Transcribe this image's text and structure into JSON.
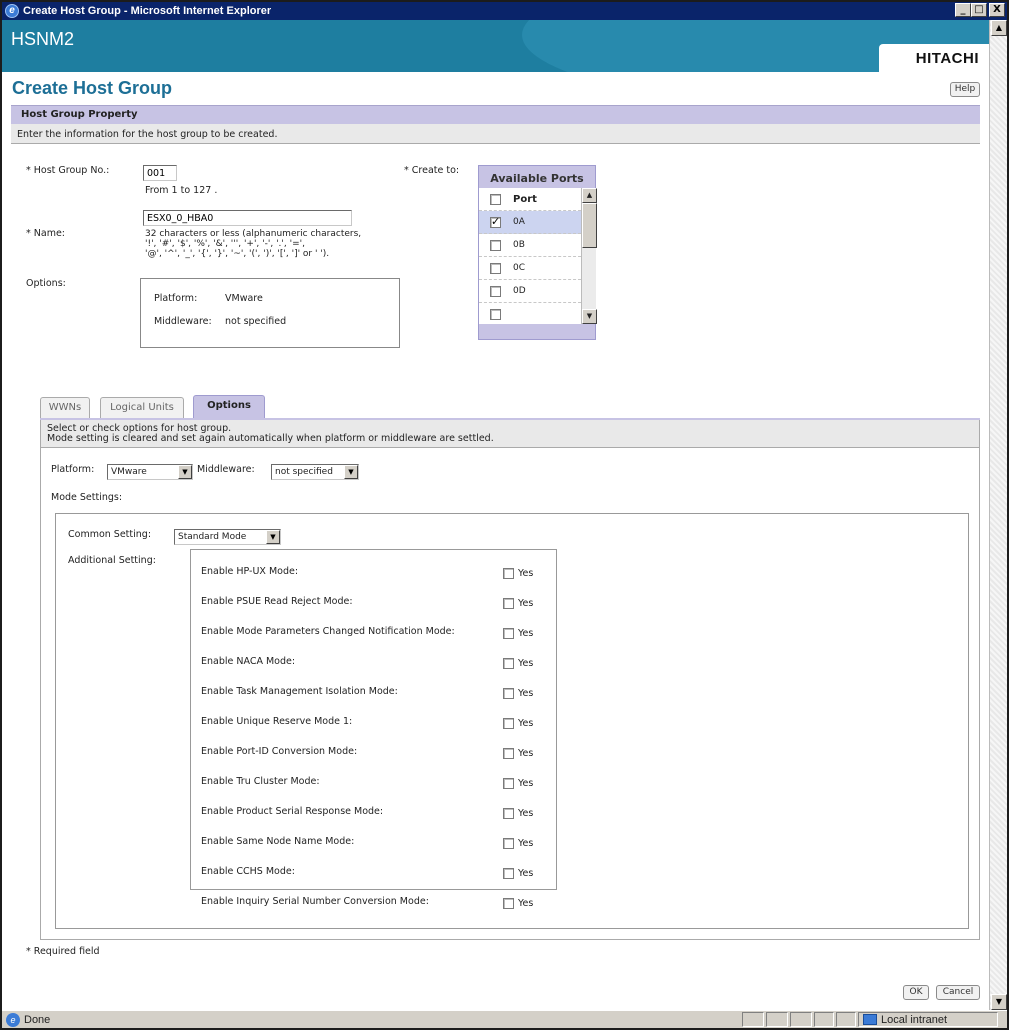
{
  "window": {
    "title": "Create Host Group - Microsoft Internet Explorer",
    "min": "_",
    "max": "□",
    "close": "X"
  },
  "banner": {
    "app_name": "HSNM2",
    "logo": "HITACHI"
  },
  "page": {
    "title": "Create Host Group",
    "help_label": "Help"
  },
  "property": {
    "header": "Host Group Property",
    "description": "Enter the information for the host group to be created.",
    "host_group_no_label": "* Host Group No.:",
    "host_group_no_value": "001",
    "host_group_no_hint": "From 1 to 127 .",
    "name_label": "* Name:",
    "name_value": "ESX0_0_HBA0",
    "name_hint_1": "32 characters or less (alphanumeric characters,",
    "name_hint_2": "'!', '#', '$', '%', '&', ''', '+', '-', '.', '=',",
    "name_hint_3": "'@', '^', '_', '{', '}', '~', '(', ')', '[', ']' or ' ').",
    "options_label": "Options:",
    "options_platform_label": "Platform:",
    "options_platform_value": "VMware",
    "options_middleware_label": "Middleware:",
    "options_middleware_value": "not specified",
    "create_to_label": "* Create to:"
  },
  "ports": {
    "title": "Available Ports",
    "column": "Port",
    "items": [
      {
        "label": "0A",
        "checked": true
      },
      {
        "label": "0B",
        "checked": false
      },
      {
        "label": "0C",
        "checked": false
      },
      {
        "label": "0D",
        "checked": false
      }
    ]
  },
  "tabs": [
    {
      "label": "WWNs",
      "active": false
    },
    {
      "label": "Logical Units",
      "active": false
    },
    {
      "label": "Options",
      "active": true
    }
  ],
  "options_tab": {
    "description_1": "Select or check options for host group.",
    "description_2": "Mode setting is cleared and set again automatically when platform or middleware are settled.",
    "platform_label": "Platform:",
    "platform_value": "VMware",
    "middleware_label": "Middleware:",
    "middleware_value": "not specified",
    "mode_settings_label": "Mode Settings:",
    "common_setting_label": "Common Setting:",
    "common_setting_value": "Standard Mode",
    "additional_setting_label": "Additional Setting:",
    "yes_label": "Yes",
    "additional": [
      "Enable HP-UX Mode:",
      "Enable PSUE Read Reject Mode:",
      "Enable Mode Parameters Changed Notification Mode:",
      "Enable NACA Mode:",
      "Enable Task Management Isolation Mode:",
      "Enable Unique Reserve Mode 1:",
      "Enable Port-ID Conversion Mode:",
      "Enable Tru Cluster Mode:",
      "Enable Product Serial Response Mode:",
      "Enable Same Node Name Mode:",
      "Enable CCHS Mode:",
      "Enable Inquiry Serial Number Conversion Mode:"
    ]
  },
  "footer": {
    "required_note": "* Required field",
    "ok_label": "OK",
    "cancel_label": "Cancel"
  },
  "statusbar": {
    "status": "Done",
    "zone": "Local intranet"
  }
}
